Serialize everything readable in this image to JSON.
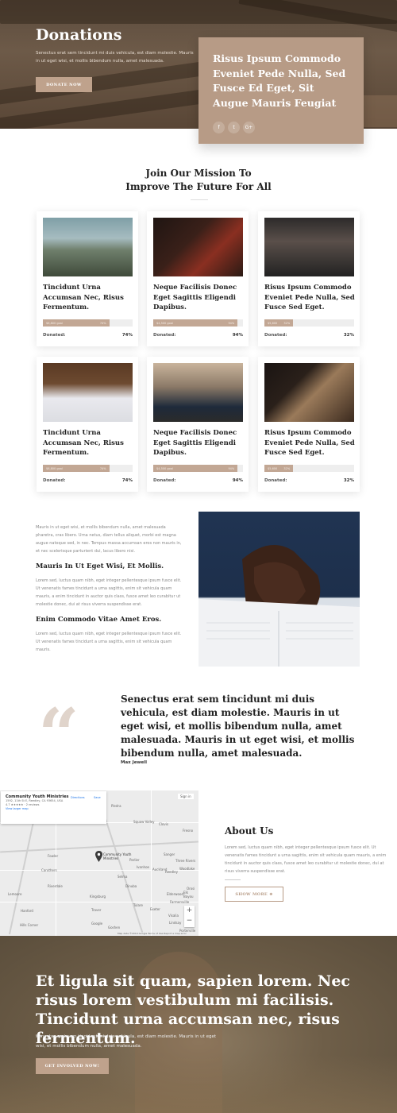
{
  "hero": {
    "title": "Donations",
    "text": "Senectus erat sem tincidunt mi duis vehicula, est diam molestie. Mauris in ut eget wisi, et mollis bibendum nulla, amet malesuada.",
    "button": "DONATE NOW",
    "card_text": "Risus Ipsum Commodo Eveniet Pede Nulla, Sed Fusce Ed Eget, Sit Augue Mauris Feugiat",
    "socials": [
      "f",
      "t",
      "G+"
    ]
  },
  "mission": {
    "title_line1": "Join Our Mission To",
    "title_line2": "Improve The Future For All"
  },
  "cards": [
    {
      "title": "Tincidunt Urna Accumsan Nec, Risus Fermentum.",
      "bar_label": "$6,800 goal",
      "bar_pct": "74%",
      "fill": 0.74,
      "donated": "Donated:",
      "pct": "74%"
    },
    {
      "title": "Neque Facilisis Donec Eget Sagittis Eligendi Dapibus.",
      "bar_label": "$4,500 goal",
      "bar_pct": "94%",
      "fill": 0.94,
      "donated": "Donated:",
      "pct": "94%"
    },
    {
      "title": "Risus Ipsum Commodo Eveniet Pede Nulla, Sed Fusce Sed Eget.",
      "bar_label": "$5,600",
      "bar_pct": "32%",
      "fill": 0.32,
      "donated": "Donated:",
      "pct": "32%"
    },
    {
      "title": "Tincidunt Urna Accumsan Nec, Risus Fermentum.",
      "bar_label": "$6,800 goal",
      "bar_pct": "74%",
      "fill": 0.74,
      "donated": "Donated:",
      "pct": "74%"
    },
    {
      "title": "Neque Facilisis Donec Eget Sagittis Eligendi Dapibus.",
      "bar_label": "$4,500 goal",
      "bar_pct": "94%",
      "fill": 0.94,
      "donated": "Donated:",
      "pct": "94%"
    },
    {
      "title": "Risus Ipsum Commodo Eveniet Pede Nulla, Sed Fusce Sed Eget.",
      "bar_label": "$5,600",
      "bar_pct": "32%",
      "fill": 0.32,
      "donated": "Donated:",
      "pct": "32%"
    }
  ],
  "article": {
    "intro": "Mauris in ut eget wisi, et mollis bibendum nulla, amet malesuada pharetra, cras libero. Urna netus, diam tellus aliquet, morbi est magna augue natoque sed, in nec. Tempus massa accumsan eros non mauris in, et nec scelerisque parturient dui, lacus libero nisi.",
    "heading1": "Mauris In Ut Eget Wisi, Et Mollis.",
    "para1": "Lorem sed, luctus quam nibh, eget integer pellentesque ipsum fusce elit. Ut venenatis fames tincidunt a urna sagittis, enim sit vehicula quam mauris, a enim tincidunt in auctor quis class, fusce amet leo curabitur ut molestie donec, dui at risus viverra suspendisse erat.",
    "heading2": "Enim Commodo Vitae Amet Eros.",
    "para2": "Lorem sed, luctus quam nibh, eget integer pellentesque ipsum fusce elit. Ut venenatis fames tincidunt a urna sagittis, enim sit vehicula quam mauris."
  },
  "quote": {
    "mark": "“",
    "text": "Senectus erat sem tincidunt mi duis vehicula, est diam molestie. Mauris in ut eget wisi, et mollis bibendum nulla, amet malesuada. Mauris in ut eget wisi, et mollis bibendum nulla, amet malesuada.",
    "author": "Max Jewell"
  },
  "map": {
    "place_name": "Community Youth Ministries",
    "address": "1592, 11th St E, Reedley, CA 93654, USA",
    "rating": "4.7 ★★★★★ · 2 reviews",
    "larger": "View larger map",
    "directions": "Directions",
    "save": "Save",
    "sign_in": "Sign in",
    "pin_label": "Community Youth Ministries",
    "zoom_in": "+",
    "zoom_out": "−",
    "footer": "Map data ©2019 Google  Terms of Use  Report a map error",
    "towns": [
      "Piedra",
      "Squaw Valley",
      "Fresno",
      "Clovis",
      "Sanger",
      "Reedley",
      "Parlier",
      "Fowler",
      "Dinuba",
      "Selma",
      "Kingsburg",
      "Orosi",
      "Woodlake",
      "Exeter",
      "Visalia",
      "Traver",
      "Caruthers",
      "Riverdale",
      "Lemoore",
      "Hanford",
      "Tulare",
      "Elderwood",
      "Farmersville",
      "Ivanhoe",
      "Goshen",
      "Lindsay",
      "Auckland",
      "Three Rivers",
      "Elk Bayou",
      "Porterville",
      "Hills Corner",
      "Google"
    ]
  },
  "about": {
    "title": "About Us",
    "text": "Lorem sed, luctus quam nibh, eget integer pellentesque ipsum fusce elit. Ut venenatis fames tincidunt a urna sagittis, enim sit vehicula quam mauris, a enim tincidunt in auctor quis class, fusce amet leo curabitur ut molestie donec, dui at risus viverra suspendisse erat.",
    "button": "SHOW MORE ⊕"
  },
  "footer": {
    "title": "Et ligula sit quam, sapien lorem. Nec risus lorem vestibulum mi facilisis. Tincidunt urna accumsan nec, risus fermentum.",
    "text": "Senectus erat sem tincidunt mi duis vehicula, est diam molestie. Mauris in ut eget wisi, et mollis bibendum nulla, amet malesuada.",
    "button": "GET INVOLVED NOW!"
  }
}
